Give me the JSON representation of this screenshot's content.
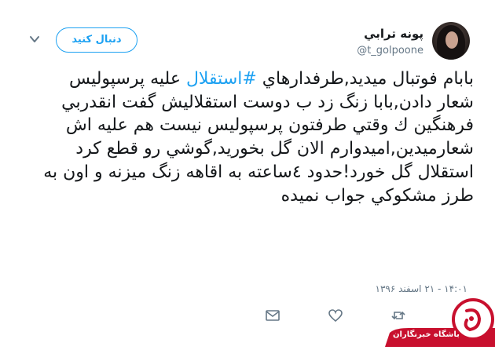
{
  "tweet": {
    "display_name": "پونه ترابي",
    "handle": "@t_golpoone",
    "follow_label": "دنبال کنید",
    "text_before_hashtag": "بابام فوتبال میدید,طرفدارهاي ",
    "hashtag": "#استقلال",
    "text_after_hashtag": " علیه پرسپولیس شعار دادن,بابا زنگ زد ب دوست استقلالیش گفت انقدربي فرهنگین ك وقتي طرفتون پرسپولیس نیست هم علیه اش شعارمیدین,امیدوارم الان گل بخورید,گوشي رو قطع کرد استقلال گل خورد!حدود ٤ساعته به اقاهه زنگ میزنه و اون به طرز مشکوکي جواب نمیده",
    "timestamp": "۱۴:۰۱ - ۲۱ اسفند ۱۳۹۶"
  },
  "icons": {
    "avatar": "profile-photo",
    "chevron": "chevron-down-icon",
    "reply": "reply-icon",
    "retweet": "retweet-icon",
    "like": "heart-icon",
    "dm": "envelope-icon"
  },
  "watermark": {
    "text": "باشگاه خبرنگاران",
    "color": "#c8102e"
  },
  "colors": {
    "accent": "#1da1f2",
    "text": "#14171a",
    "muted": "#657786"
  }
}
